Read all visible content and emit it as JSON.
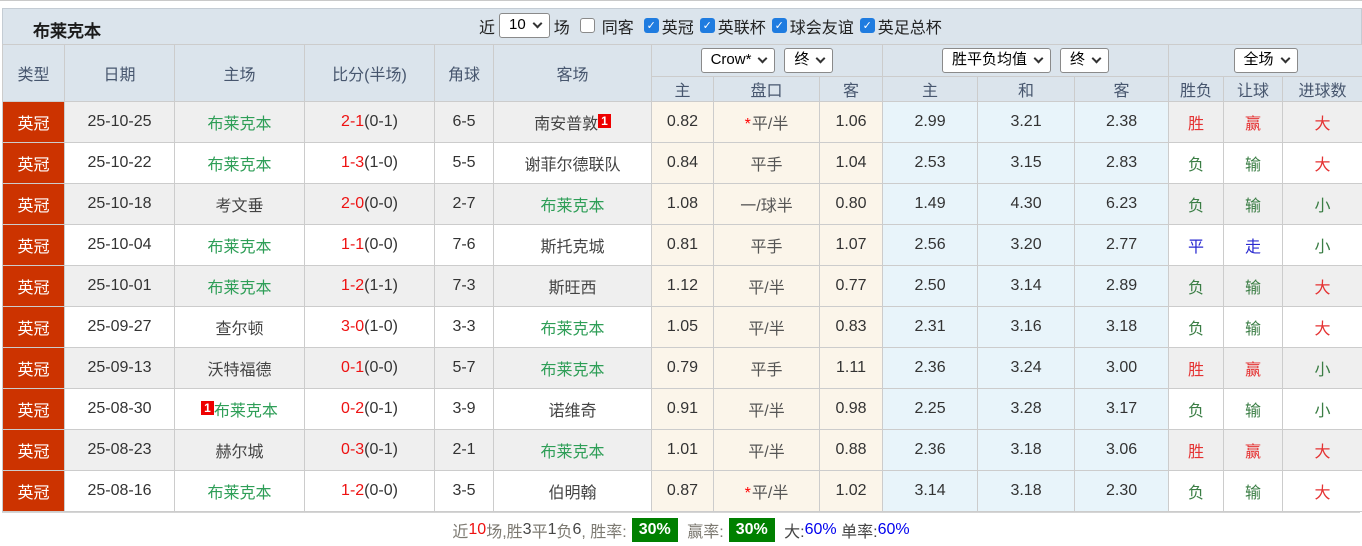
{
  "title": "布莱克本",
  "topbar": {
    "near_label": "近",
    "count_select_value": "10",
    "games_label": "场",
    "same_opponent_label": "同客",
    "filters": [
      {
        "label": "英冠",
        "checked": true
      },
      {
        "label": "英联杯",
        "checked": true
      },
      {
        "label": "球会友谊",
        "checked": true
      },
      {
        "label": "英足总杯",
        "checked": true
      }
    ]
  },
  "header": {
    "col_type": "类型",
    "col_date": "日期",
    "col_home": "主场",
    "col_score": "比分(半场)",
    "col_corner": "角球",
    "col_away": "客场",
    "bookmaker_select_value": "Crow*",
    "bookmaker_time_select_value": "终",
    "avg_select_value": "胜平负均值",
    "avg_time_select_value": "终",
    "scope_select_value": "全场",
    "sub_home_odds": "主",
    "sub_handicap": "盘口",
    "sub_away_odds": "客",
    "sub_avg_home": "主",
    "sub_avg_draw": "和",
    "sub_avg_away": "客",
    "sub_wdl": "胜负",
    "sub_spread": "让球",
    "sub_goals": "进球数"
  },
  "colors": {
    "type_badge_bg": "#cc3300",
    "self_team_green": "#2e9e57",
    "score_red": "#ee1111",
    "win_red": "#e53333",
    "lose_green": "#3a7d44",
    "draw_blue": "#2a2ad0",
    "rate_box_green": "#008000",
    "rate_blue": "#0000ee",
    "header_bg": "#dbe4ec",
    "odds_cream_bg": "#fbf5ea",
    "avg_blue_bg": "#e8f4fa"
  },
  "rows": [
    {
      "league": "英冠",
      "date": "25-10-25",
      "home": "布莱克本",
      "home_self": true,
      "home_badge": "",
      "away": "南安普敦",
      "away_self": false,
      "away_badge": "1",
      "score": "2-1",
      "half": "(0-1)",
      "corners": "6-5",
      "oh": "0.82",
      "line": "平/半",
      "line_star": true,
      "oa": "1.06",
      "ah": "2.99",
      "ad": "3.21",
      "aa": "2.38",
      "r1": "胜",
      "r1c": "red",
      "r2": "赢",
      "r2c": "red",
      "r3": "大",
      "r3c": "red"
    },
    {
      "league": "英冠",
      "date": "25-10-22",
      "home": "布莱克本",
      "home_self": true,
      "home_badge": "",
      "away": "谢菲尔德联队",
      "away_self": false,
      "away_badge": "",
      "score": "1-3",
      "half": "(1-0)",
      "corners": "5-5",
      "oh": "0.84",
      "line": "平手",
      "line_star": false,
      "oa": "1.04",
      "ah": "2.53",
      "ad": "3.15",
      "aa": "2.83",
      "r1": "负",
      "r1c": "green",
      "r2": "输",
      "r2c": "green",
      "r3": "大",
      "r3c": "red"
    },
    {
      "league": "英冠",
      "date": "25-10-18",
      "home": "考文垂",
      "home_self": false,
      "home_badge": "",
      "away": "布莱克本",
      "away_self": true,
      "away_badge": "",
      "score": "2-0",
      "half": "(0-0)",
      "corners": "2-7",
      "oh": "1.08",
      "line": "一/球半",
      "line_star": false,
      "oa": "0.80",
      "ah": "1.49",
      "ad": "4.30",
      "aa": "6.23",
      "r1": "负",
      "r1c": "green",
      "r2": "输",
      "r2c": "green",
      "r3": "小",
      "r3c": "green"
    },
    {
      "league": "英冠",
      "date": "25-10-04",
      "home": "布莱克本",
      "home_self": true,
      "home_badge": "",
      "away": "斯托克城",
      "away_self": false,
      "away_badge": "",
      "score": "1-1",
      "half": "(0-0)",
      "corners": "7-6",
      "oh": "0.81",
      "line": "平手",
      "line_star": false,
      "oa": "1.07",
      "ah": "2.56",
      "ad": "3.20",
      "aa": "2.77",
      "r1": "平",
      "r1c": "blue",
      "r2": "走",
      "r2c": "blue",
      "r3": "小",
      "r3c": "green"
    },
    {
      "league": "英冠",
      "date": "25-10-01",
      "home": "布莱克本",
      "home_self": true,
      "home_badge": "",
      "away": "斯旺西",
      "away_self": false,
      "away_badge": "",
      "score": "1-2",
      "half": "(1-1)",
      "corners": "7-3",
      "oh": "1.12",
      "line": "平/半",
      "line_star": false,
      "oa": "0.77",
      "ah": "2.50",
      "ad": "3.14",
      "aa": "2.89",
      "r1": "负",
      "r1c": "green",
      "r2": "输",
      "r2c": "green",
      "r3": "大",
      "r3c": "red"
    },
    {
      "league": "英冠",
      "date": "25-09-27",
      "home": "查尔顿",
      "home_self": false,
      "home_badge": "",
      "away": "布莱克本",
      "away_self": true,
      "away_badge": "",
      "score": "3-0",
      "half": "(1-0)",
      "corners": "3-3",
      "oh": "1.05",
      "line": "平/半",
      "line_star": false,
      "oa": "0.83",
      "ah": "2.31",
      "ad": "3.16",
      "aa": "3.18",
      "r1": "负",
      "r1c": "green",
      "r2": "输",
      "r2c": "green",
      "r3": "大",
      "r3c": "red"
    },
    {
      "league": "英冠",
      "date": "25-09-13",
      "home": "沃特福德",
      "home_self": false,
      "home_badge": "",
      "away": "布莱克本",
      "away_self": true,
      "away_badge": "",
      "score": "0-1",
      "half": "(0-0)",
      "corners": "5-7",
      "oh": "0.79",
      "line": "平手",
      "line_star": false,
      "oa": "1.11",
      "ah": "2.36",
      "ad": "3.24",
      "aa": "3.00",
      "r1": "胜",
      "r1c": "red",
      "r2": "赢",
      "r2c": "red",
      "r3": "小",
      "r3c": "green"
    },
    {
      "league": "英冠",
      "date": "25-08-30",
      "home": "布莱克本",
      "home_self": true,
      "home_badge": "1",
      "away": "诺维奇",
      "away_self": false,
      "away_badge": "",
      "score": "0-2",
      "half": "(0-1)",
      "corners": "3-9",
      "oh": "0.91",
      "line": "平/半",
      "line_star": false,
      "oa": "0.98",
      "ah": "2.25",
      "ad": "3.28",
      "aa": "3.17",
      "r1": "负",
      "r1c": "green",
      "r2": "输",
      "r2c": "green",
      "r3": "小",
      "r3c": "green"
    },
    {
      "league": "英冠",
      "date": "25-08-23",
      "home": "赫尔城",
      "home_self": false,
      "home_badge": "",
      "away": "布莱克本",
      "away_self": true,
      "away_badge": "",
      "score": "0-3",
      "half": "(0-1)",
      "corners": "2-1",
      "oh": "1.01",
      "line": "平/半",
      "line_star": false,
      "oa": "0.88",
      "ah": "2.36",
      "ad": "3.18",
      "aa": "3.06",
      "r1": "胜",
      "r1c": "red",
      "r2": "赢",
      "r2c": "red",
      "r3": "大",
      "r3c": "red"
    },
    {
      "league": "英冠",
      "date": "25-08-16",
      "home": "布莱克本",
      "home_self": true,
      "home_badge": "",
      "away": "伯明翰",
      "away_self": false,
      "away_badge": "",
      "score": "1-2",
      "half": "(0-0)",
      "corners": "3-5",
      "oh": "0.87",
      "line": "平/半",
      "line_star": true,
      "oa": "1.02",
      "ah": "3.14",
      "ad": "3.18",
      "aa": "2.30",
      "r1": "负",
      "r1c": "green",
      "r2": "输",
      "r2c": "green",
      "r3": "大",
      "r3c": "red"
    }
  ],
  "footer": {
    "parts": [
      {
        "t": "近",
        "c": "fp-gray"
      },
      {
        "t": "10",
        "c": "fp-red"
      },
      {
        "t": "场,胜",
        "c": "fp-gray"
      },
      {
        "t": "3",
        "c": "fp-dark"
      },
      {
        "t": "平",
        "c": "fp-gray"
      },
      {
        "t": "1",
        "c": "fp-dark"
      },
      {
        "t": "负",
        "c": "fp-gray"
      },
      {
        "t": "6",
        "c": "fp-dark"
      },
      {
        "t": ", 胜率:",
        "c": "fp-gray"
      },
      {
        "t": "30%",
        "c": "fp-greenbox"
      },
      {
        "t": " 赢率:",
        "c": "fp-gray"
      },
      {
        "t": "30%",
        "c": "fp-greenbox"
      },
      {
        "t": " 大:",
        "c": "fp-dark"
      },
      {
        "t": "60%",
        "c": "fp-blue"
      },
      {
        "t": " 单率:",
        "c": "fp-dark"
      },
      {
        "t": "60%",
        "c": "fp-blue"
      }
    ]
  }
}
